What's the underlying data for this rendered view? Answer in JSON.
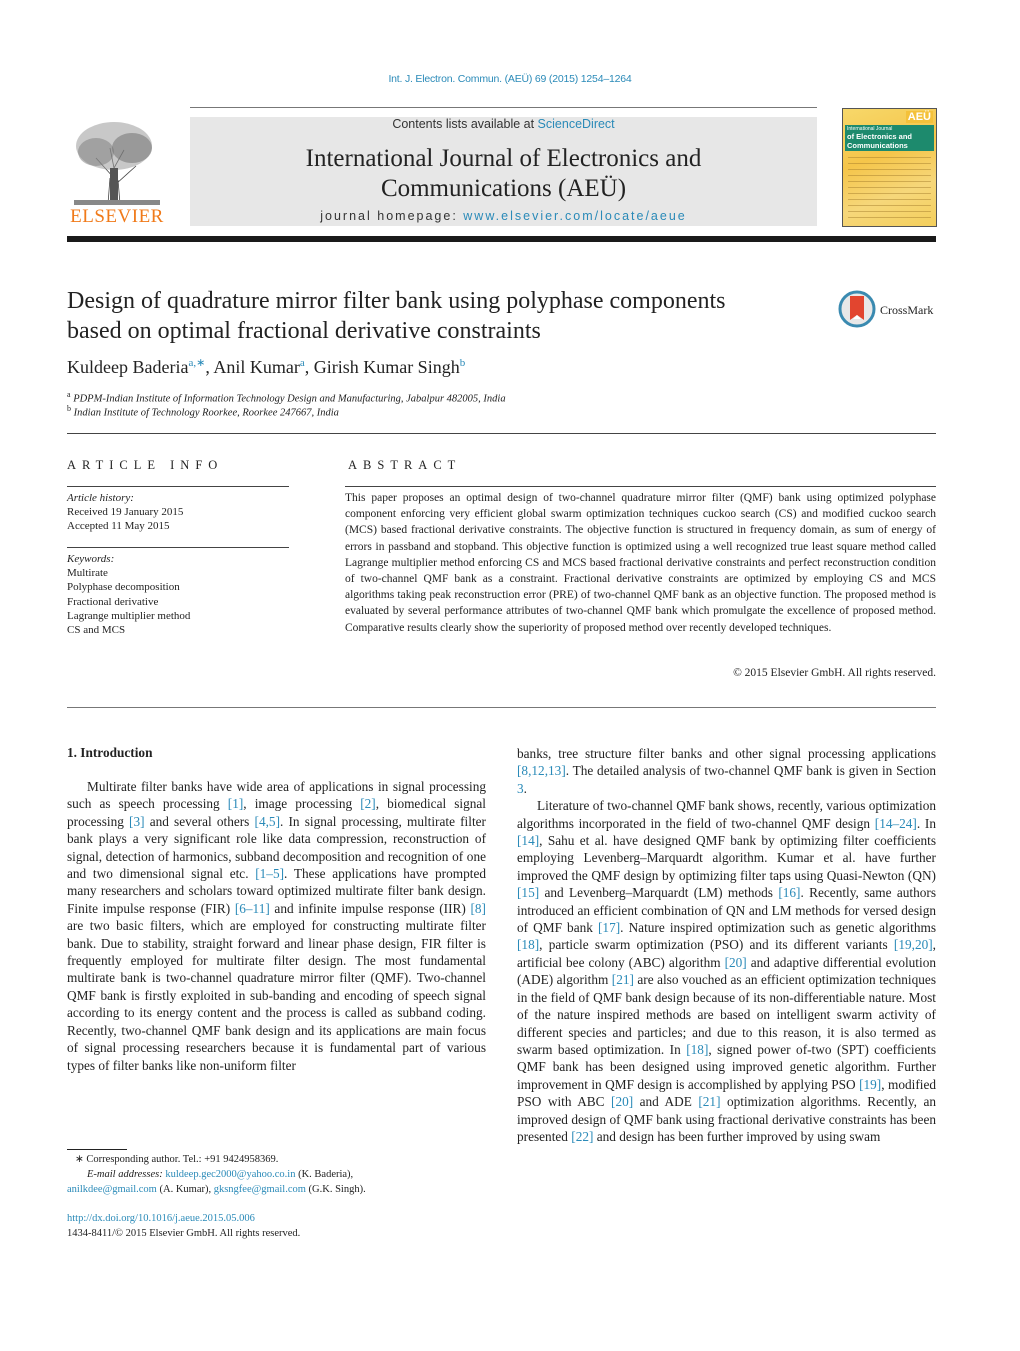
{
  "header": {
    "citation": "Int. J. Electron. Commun. (AEÜ) 69 (2015) 1254–1264",
    "contents_prefix": "Contents lists available at ",
    "contents_link": "ScienceDirect",
    "journal_title_line1": "International Journal of Electronics and",
    "journal_title_line2": "Communications (AEÜ)",
    "homepage_prefix": "journal homepage: ",
    "homepage_link": "www.elsevier.com/locate/aeue",
    "publisher_logo": "ELSEVIER",
    "cover": {
      "tag": "AEÜ",
      "band_line1": "International Journal",
      "band_line2": "of Electronics and",
      "band_line3": "Communications"
    },
    "colors": {
      "link": "#2a8ab8",
      "elsevier_orange": "#f07a1a",
      "header_bg": "#e7e7e7"
    }
  },
  "article": {
    "title_line1": "Design of quadrature mirror filter bank using polyphase components",
    "title_line2": "based on optimal fractional derivative constraints",
    "crossmark_label": "CrossMark",
    "authors": [
      {
        "name": "Kuldeep Baderia",
        "sup": "a,∗"
      },
      {
        "name": "Anil Kumar",
        "sup": "a"
      },
      {
        "name": "Girish Kumar Singh",
        "sup": "b"
      }
    ],
    "affiliations": [
      {
        "sup": "a",
        "text": "PDPM-Indian Institute of Information Technology Design and Manufacturing, Jabalpur 482005, India"
      },
      {
        "sup": "b",
        "text": "Indian Institute of Technology Roorkee, Roorkee 247667, India"
      }
    ]
  },
  "article_info": {
    "heading": "ARTICLE INFO",
    "history_label": "Article history:",
    "received": "Received 19 January 2015",
    "accepted": "Accepted 11 May 2015",
    "keywords_label": "Keywords:",
    "keywords": [
      "Multirate",
      "Polyphase decomposition",
      "Fractional derivative",
      "Lagrange multiplier method",
      "CS and MCS"
    ]
  },
  "abstract": {
    "heading": "ABSTRACT",
    "text": "This paper proposes an optimal design of two-channel quadrature mirror filter (QMF) bank using optimized polyphase component enforcing very efficient global swarm optimization techniques cuckoo search (CS) and modified cuckoo search (MCS) based fractional derivative constraints. The objective function is structured in frequency domain, as sum of energy of errors in passband and stopband. This objective function is optimized using a well recognized true least square method called Lagrange multiplier method enforcing CS and MCS based fractional derivative constraints and perfect reconstruction condition of two-channel QMF bank as a constraint. Fractional derivative constraints are optimized by employing CS and MCS algorithms taking peak reconstruction error (PRE) of two-channel QMF bank as an objective function. The proposed method is evaluated by several performance attributes of two-channel QMF bank which promulgate the excellence of proposed method. Comparative results clearly show the superiority of proposed method over recently developed techniques.",
    "copyright": "© 2015 Elsevier GmbH. All rights reserved."
  },
  "body": {
    "section_heading": "1.  Introduction",
    "left_column": [
      [
        "Multirate filter banks have wide area of applications in signal processing such as speech processing ",
        {
          "ref": "[1]"
        },
        ", image processing ",
        {
          "ref": "[2]"
        },
        ", biomedical signal processing ",
        {
          "ref": "[3]"
        },
        " and several others ",
        {
          "ref": "[4,5]"
        },
        ". In signal processing, multirate filter bank plays a very significant role like data compression, reconstruction of signal, detection of harmonics, subband decomposition and recognition of one and two dimensional signal etc. ",
        {
          "ref": "[1–5]"
        },
        ". These applications have prompted many researchers and scholars toward optimized multirate filter bank design. Finite impulse response (FIR) ",
        {
          "ref": "[6–11]"
        },
        " and infinite impulse response (IIR) ",
        {
          "ref": "[8]"
        },
        " are two basic filters, which are employed for constructing multirate filter bank. Due to stability, straight forward and linear phase design, FIR filter is frequently employed for multirate filter design. The most fundamental multirate bank is two-channel quadrature mirror filter (QMF). Two-channel QMF bank is firstly exploited in sub-banding and encoding of speech signal according to its energy content and the process is called as subband coding. Recently, two-channel QMF bank design and its applications are main focus of signal processing researchers because it is fundamental part of various types of filter banks like non-uniform filter"
      ]
    ],
    "right_column": [
      [
        "banks, tree structure filter banks and other signal processing applications ",
        {
          "ref": "[8,12,13]"
        },
        ". The detailed analysis of two-channel QMF bank is given in Section ",
        {
          "ref": "3"
        },
        "."
      ],
      [
        "Literature of two-channel QMF bank shows, recently, various optimization algorithms incorporated in the field of two-channel QMF design ",
        {
          "ref": "[14–24]"
        },
        ". In ",
        {
          "ref": "[14]"
        },
        ", Sahu et al. have designed QMF bank by optimizing filter coefficients employing Levenberg–Marquardt algorithm. Kumar et al. have further improved the QMF design by optimizing filter taps using Quasi-Newton (QN) ",
        {
          "ref": "[15]"
        },
        " and Levenberg–Marquardt (LM) methods ",
        {
          "ref": "[16]"
        },
        ". Recently, same authors introduced an efficient combination of QN and LM methods for versed design of QMF bank ",
        {
          "ref": "[17]"
        },
        ". Nature inspired optimization such as genetic algorithms ",
        {
          "ref": "[18]"
        },
        ", particle swarm optimization (PSO) and its different variants ",
        {
          "ref": "[19,20]"
        },
        ", artificial bee colony (ABC) algorithm ",
        {
          "ref": "[20]"
        },
        " and adaptive differential evolution (ADE) algorithm ",
        {
          "ref": "[21]"
        },
        " are also vouched as an efficient optimization techniques in the field of QMF bank design because of its non-differentiable nature. Most of the nature inspired methods are based on intelligent swarm activity of different species and particles; and due to this reason, it is also termed as swarm based optimization. In ",
        {
          "ref": "[18]"
        },
        ", signed power of-two (SPT) coefficients QMF bank has been designed using improved genetic algorithm. Further improvement in QMF design is accomplished by applying PSO ",
        {
          "ref": "[19]"
        },
        ", modified PSO with ABC ",
        {
          "ref": "[20]"
        },
        " and ADE ",
        {
          "ref": "[21]"
        },
        " optimization algorithms. Recently, an improved design of QMF bank using fractional derivative constraints has been presented ",
        {
          "ref": "[22]"
        },
        " and design has been further improved by using swam"
      ]
    ]
  },
  "footnotes": {
    "corresponding": "∗  Corresponding author. Tel.: +91 9424958369.",
    "email_label": "E-mail addresses: ",
    "emails": [
      {
        "address": "kuldeep.gec2000@yahoo.co.in",
        "owner": " (K. Baderia),"
      },
      {
        "address": "anilkdee@gmail.com",
        "owner": " (A. Kumar), "
      },
      {
        "address": "gksngfee@gmail.com",
        "owner": " (G.K. Singh)."
      }
    ],
    "doi": "http://dx.doi.org/10.1016/j.aeue.2015.05.006",
    "issn_copyright": "1434-8411/© 2015 Elsevier GmbH. All rights reserved."
  }
}
